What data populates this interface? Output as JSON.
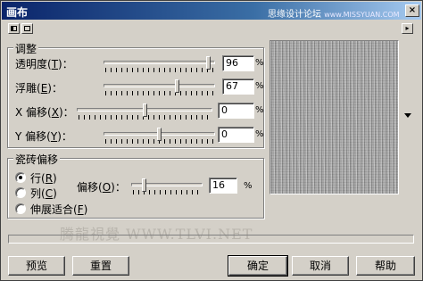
{
  "window": {
    "title": "画布"
  },
  "watermark": {
    "top_cn": "思缘设计论坛",
    "top_url": "www.MISSYUAN.COM",
    "mid": "腾龍視覺 WWW.TLVI.NET"
  },
  "close_glyph": "×",
  "toolbar": {
    "icons": [
      "single-page-icon",
      "dual-page-icon"
    ],
    "arrow_glyph": "▸"
  },
  "adjust": {
    "title": "调整",
    "rows": [
      {
        "label": "透明度",
        "key": "T",
        "value": "96",
        "fill": 0.96,
        "unit": "%"
      },
      {
        "label": "浮雕",
        "key": "E",
        "value": "67",
        "fill": 0.67,
        "unit": "%"
      },
      {
        "label": "X 偏移",
        "key": "X",
        "value": "0",
        "fill": 0.5,
        "unit": "%"
      },
      {
        "label": "Y 偏移",
        "key": "Y",
        "value": "0",
        "fill": 0.5,
        "unit": "%"
      }
    ]
  },
  "tile_offset": {
    "title": "瓷砖偏移",
    "options": [
      {
        "label": "行",
        "key": "R",
        "selected": true
      },
      {
        "label": "列",
        "key": "C",
        "selected": false
      },
      {
        "label": "伸展适合",
        "key": "F",
        "selected": false
      }
    ],
    "offset": {
      "label": "偏移",
      "key": "O",
      "value": "16",
      "fill": 0.16,
      "unit": "%"
    }
  },
  "buttons": {
    "preview": "预览",
    "reset": "重置",
    "ok": "确定",
    "cancel": "取消",
    "help": "帮助"
  }
}
